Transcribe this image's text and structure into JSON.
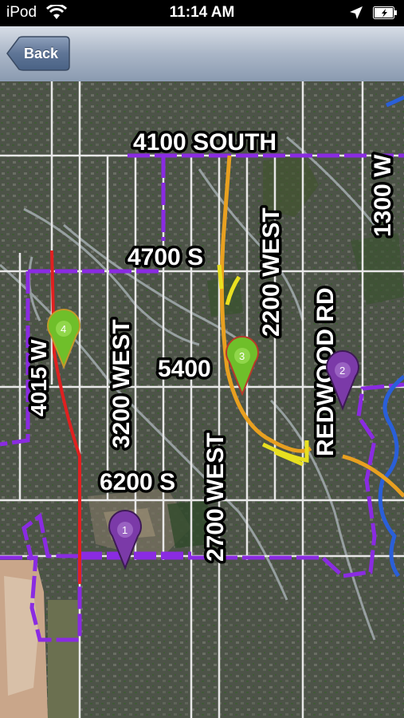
{
  "status": {
    "carrier": "iPod",
    "time": "11:14 AM"
  },
  "nav": {
    "back_label": "Back"
  },
  "map": {
    "streets": [
      "4100 SOUTH",
      "1300 W",
      "4700 S",
      "2200 WEST",
      "REDWOOD RD",
      "4015 W",
      "3200 WEST",
      "5400",
      "6200 S",
      "2700 WEST"
    ],
    "pins": [
      {
        "label": "1",
        "color": "#7b3aa8"
      },
      {
        "label": "2",
        "color": "#7b3aa8"
      },
      {
        "label": "3",
        "color": "#6fbf2a"
      },
      {
        "label": "4",
        "color": "#6fbf2a"
      }
    ],
    "route_colors": {
      "purple": "#8a2be2",
      "orange": "#e8a020",
      "yellow": "#e8e020",
      "red": "#e02020",
      "blue": "#2a5fd8"
    }
  }
}
